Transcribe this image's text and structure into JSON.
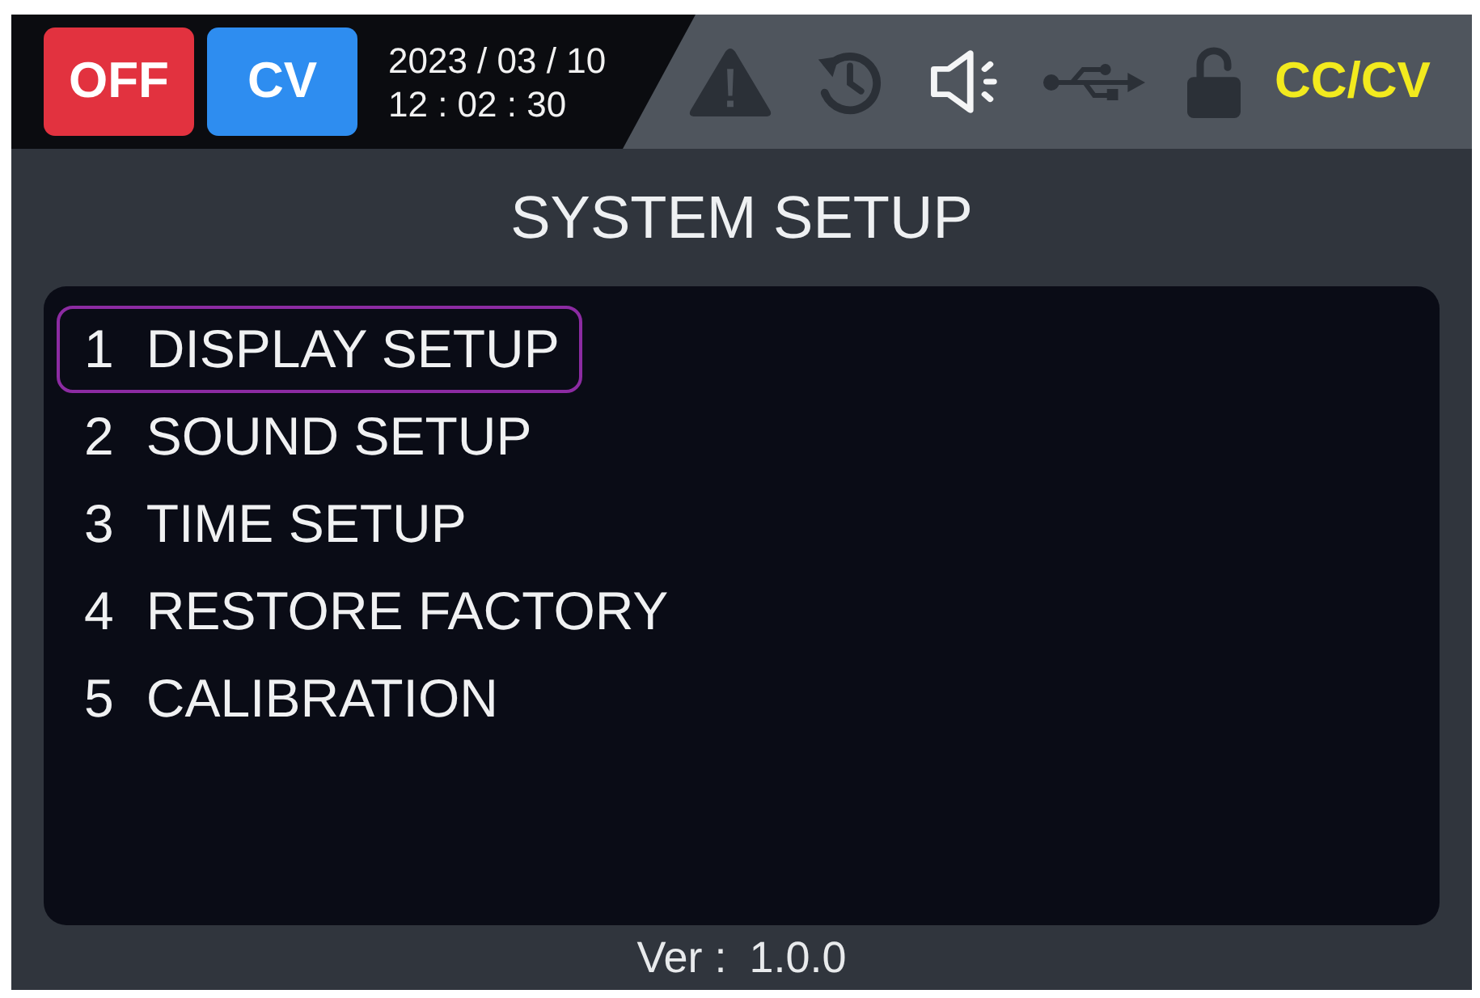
{
  "header": {
    "badges": [
      {
        "label": "OFF",
        "color": "#e2323f"
      },
      {
        "label": "CV",
        "color": "#2e8df0"
      }
    ],
    "date": "2023 / 03 / 10",
    "time": "12 : 02 : 30",
    "status_icons": [
      {
        "kind": "warning",
        "active": false
      },
      {
        "kind": "history",
        "active": false
      },
      {
        "kind": "sound",
        "active": true
      },
      {
        "kind": "usb",
        "active": false
      },
      {
        "kind": "lock",
        "active": false
      }
    ],
    "mode": "CC/CV"
  },
  "title": "SYSTEM SETUP",
  "menu": {
    "items": [
      {
        "number": "1",
        "label": "DISPLAY SETUP",
        "selected": true
      },
      {
        "number": "2",
        "label": "SOUND SETUP",
        "selected": false
      },
      {
        "number": "3",
        "label": "TIME SETUP",
        "selected": false
      },
      {
        "number": "4",
        "label": "RESTORE FACTORY",
        "selected": false
      },
      {
        "number": "5",
        "label": "CALIBRATION",
        "selected": false
      }
    ]
  },
  "footer": {
    "label": "Ver :",
    "value": "1.0.0"
  }
}
